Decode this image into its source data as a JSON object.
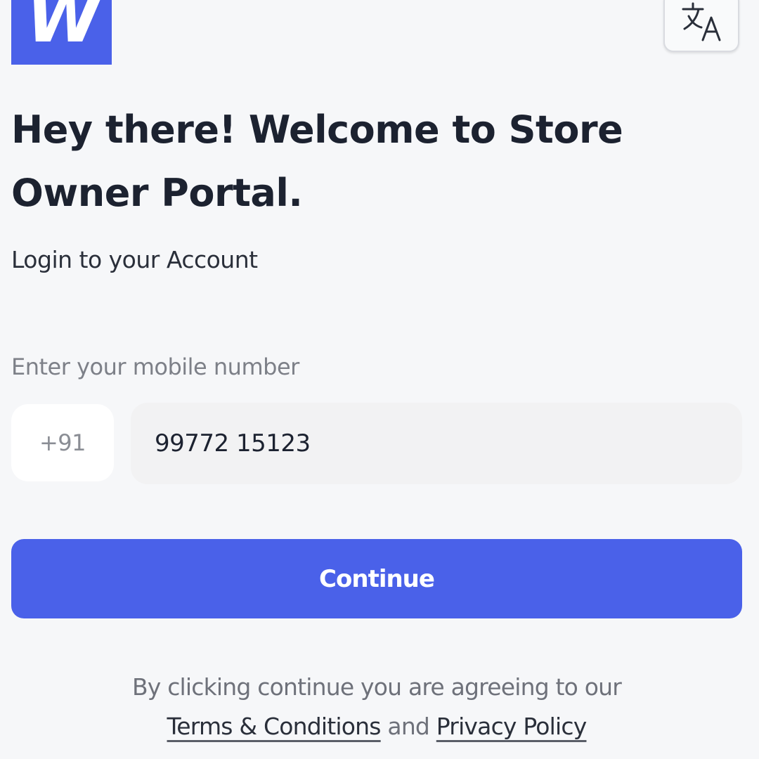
{
  "brand": {
    "logo_text": "W",
    "accent_color": "#4a61e9"
  },
  "toolbar": {
    "language_icon": "translate-icon"
  },
  "header": {
    "title": "Hey there! Welcome to Store Owner Portal.",
    "subtitle": "Login to your Account"
  },
  "form": {
    "mobile_label": "Enter your mobile number",
    "country_code": "+91",
    "phone_value": "99772 15123",
    "continue_label": "Continue"
  },
  "legal": {
    "prefix": "By clicking continue you are agreeing to our",
    "terms_label": "Terms & Conditions",
    "conjunction": "and",
    "privacy_label": "Privacy Policy"
  }
}
